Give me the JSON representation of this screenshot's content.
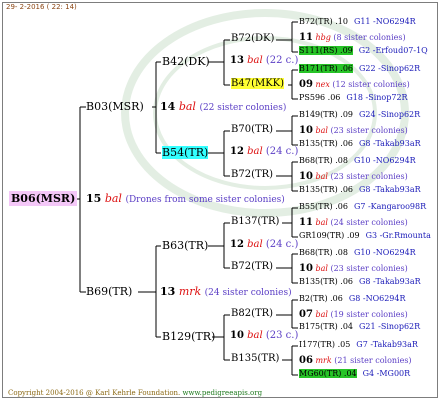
{
  "header": {
    "date": "29-  2-2016 ( 22: 14)"
  },
  "footer": {
    "copyright": "Copyright 2004-2016 @ Karl Kehrle Foundation.",
    "url": "www.pedigreeapis.org"
  },
  "colors": {
    "root_bg": "#f4c7f8",
    "yellow_hl": "#ffff33",
    "cyan_hl": "#33ffff",
    "green_hl": "#27c427",
    "bee_line": "#d11111",
    "desc": "#5b3ec5",
    "leaf_code": "#1a1ab8"
  },
  "root": {
    "label": "B06(MSR)",
    "num": "15",
    "sup": "bal",
    "desc": "(Drones from some sister colonies)"
  },
  "g1": {
    "top": {
      "label": "B03(MSR)",
      "num": "14",
      "sup": "bal",
      "desc": "(22 sister colonies)"
    },
    "bottom": {
      "label": "B69(TR)",
      "num": "13",
      "sup": "mrk",
      "desc": "(24 sister colonies)"
    }
  },
  "g2": [
    {
      "label": "B42(DK)",
      "num": "13",
      "sup": "bal",
      "desc": "(22 c.)"
    },
    {
      "label": "B54(TR)",
      "num": "12",
      "sup": "bal",
      "desc": "(24 c.)"
    },
    {
      "label": "B63(TR)",
      "num": "12",
      "sup": "bal",
      "desc": "(24 c.)"
    },
    {
      "label": "B129(TR)",
      "num": "10",
      "sup": "bal",
      "desc": "(23 c.)"
    }
  ],
  "g3": [
    {
      "label": "B72(DK)"
    },
    {
      "label": "B47(MKK)"
    },
    {
      "label": "B70(TR)"
    },
    {
      "label": "B72(TR)"
    },
    {
      "label": "B137(TR)"
    },
    {
      "label": "B72(TR)"
    },
    {
      "label": "B82(TR)"
    },
    {
      "label": "B135(TR)"
    }
  ],
  "leaves": [
    {
      "a": "B72(TR) .10",
      "b": "G11 -NO6294R"
    },
    {
      "num": "11",
      "sup": "hbg",
      "desc": "(8 sister colonies)"
    },
    {
      "a": "S111(RS) .09",
      "b": "G2 -Erfoud07-1Q"
    },
    {
      "a": "B171(TR) .06",
      "b": "G22 -Sinop62R"
    },
    {
      "num": "09",
      "sup": "nex",
      "desc": "(12 sister colonies)"
    },
    {
      "a": "PS596 .06",
      "b": "G18 -Sinop72R"
    },
    {
      "a": "B149(TR) .09",
      "b": "G24 -Sinop62R"
    },
    {
      "num": "10",
      "sup": "bal",
      "desc": "(23 sister colonies)"
    },
    {
      "a": "B135(TR) .06",
      "b": "G8 -Takab93aR"
    },
    {
      "a": "B68(TR) .08",
      "b": "G10 -NO6294R"
    },
    {
      "num": "10",
      "sup": "bal",
      "desc": "(23 sister colonies)"
    },
    {
      "a": "B135(TR) .06",
      "b": "G8 -Takab93aR"
    },
    {
      "a": "B55(TR) .06",
      "b": "G7 -Kangaroo98R"
    },
    {
      "num": "11",
      "sup": "bal",
      "desc": "(24 sister colonies)"
    },
    {
      "a": "GR109(TR) .09",
      "b": "G3 -Gr.Rmounta"
    },
    {
      "a": "B68(TR) .08",
      "b": "G10 -NO6294R"
    },
    {
      "num": "10",
      "sup": "bal",
      "desc": "(23 sister colonies)"
    },
    {
      "a": "B135(TR) .06",
      "b": "G8 -Takab93aR"
    },
    {
      "a": "B2(TR) .06",
      "b": "G8 -NO6294R"
    },
    {
      "num": "07",
      "sup": "bal",
      "desc": "(19 sister colonies)"
    },
    {
      "a": "B175(TR) .04",
      "b": "G21 -Sinop62R"
    },
    {
      "a": "I177(TR) .05",
      "b": "G7 -Takab93aR"
    },
    {
      "num": "06",
      "sup": "mrk",
      "desc": "(21 sister colonies)"
    },
    {
      "a": "MG60(TR) .04",
      "b": "G4 -MG00R"
    }
  ]
}
